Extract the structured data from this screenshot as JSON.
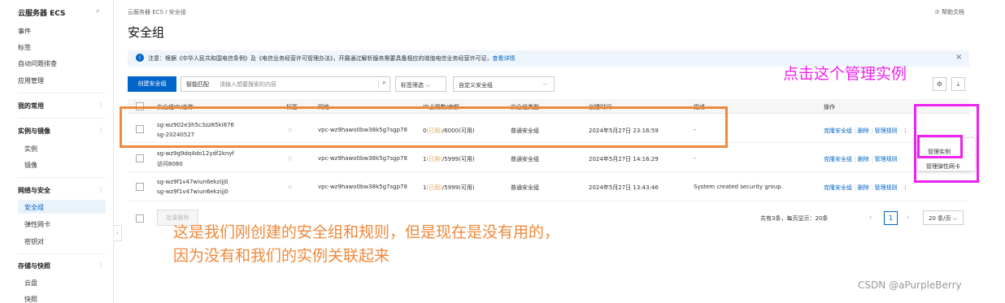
{
  "sidebar": {
    "title": "云服务器 ECS",
    "search_icon": "search-icon",
    "items_top": [
      "事件",
      "标签",
      "自动问题排查",
      "应用管理"
    ],
    "groups": [
      {
        "label": "我的常用",
        "children": []
      },
      {
        "label": "实例与镜像",
        "children": [
          "实例",
          "镜像"
        ]
      },
      {
        "label": "网络与安全",
        "children": [
          "安全组",
          "弹性网卡",
          "密钥对"
        ]
      },
      {
        "label": "存储与快照",
        "children": [
          "云盘",
          "快照"
        ]
      }
    ],
    "collapse": "‹"
  },
  "breadcrumb": "云服务器 ECS / 安全组",
  "help": "⑦ 帮助文档",
  "page_title": "安全组",
  "notice": {
    "text": "注意：根据《中华人民共和国电信条例》及《电信业务经营许可管理办法》，开展通过解析服务需要具备相应的增值电信业务经营许可证，",
    "link": "查看详情",
    "close": "×"
  },
  "toolbar": {
    "create": "创建安全组",
    "search_mode": "智能匹配",
    "search_placeholder": "请输入想要搜索的内容",
    "tag_filter": "标签筛选",
    "custom_placeholder": "自定义安全组"
  },
  "table": {
    "headers": [
      "安全组ID/名称",
      "标签",
      "网络",
      "ID占用数/余额",
      "安全组类型",
      "创建时间",
      "描述",
      "操作"
    ],
    "rows": [
      {
        "id": "sg-wz902e3h5c3zz85ki876",
        "name": "sg-20240527",
        "vpc": "vpc-wz9hawo0bw38k5g7sgp78",
        "used": "0",
        "used_label": "(已用)",
        "avail": "/6000(可用)",
        "type": "普通安全组",
        "created": "2024年5月27日 23:16:59",
        "desc": "-"
      },
      {
        "id": "sg-wz9g9dq4do12ydf2knyf",
        "name": "访问8080",
        "vpc": "vpc-wz9hawo0bw38k5g7sgp78",
        "used": "1",
        "used_label": "(已用)",
        "avail": "/5999(可用)",
        "type": "普通安全组",
        "created": "2024年5月27日 14:16:29",
        "desc": "-"
      },
      {
        "id": "sg-wz9f1v47wiun6ekzijj0",
        "name": "sg-wz9f1v47wiun6ekzijj0",
        "vpc": "vpc-wz9hawo0bw38k5g7sgp78",
        "used": "1",
        "used_label": "(已用)",
        "avail": "/5999(可用)",
        "type": "普通安全组",
        "created": "2024年5月27日 13:43:46",
        "desc": "System created security group."
      }
    ],
    "actions": {
      "clone": "克隆安全组",
      "delete": "删除",
      "rules": "管理规则"
    },
    "dropdown": [
      "管理实例",
      "管理弹性网卡"
    ]
  },
  "footer": {
    "batch_delete": "批量删除",
    "summary": "共有3条，每页显示：20条",
    "page": "1",
    "per_page": "20 条/页"
  },
  "annotations": {
    "click_hint": "点击这个管理实例",
    "note_line1": "这是我们刚创建的安全组和规则，但是现在是没有用的，",
    "note_line2": "因为没有和我们的实例关联起来"
  },
  "watermark": "CSDN @aPurpleBerry",
  "colors": {
    "primary": "#0064c8",
    "annotation_orange": "#f0883a",
    "annotation_pink": "#ee22ee"
  }
}
